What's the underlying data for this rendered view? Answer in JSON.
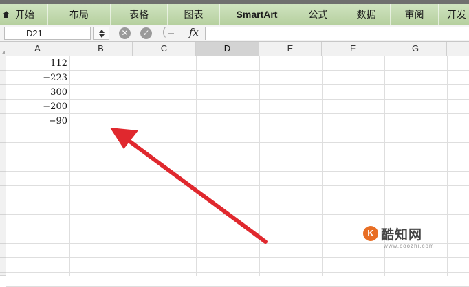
{
  "ribbon": {
    "tabs": [
      {
        "label": "开始"
      },
      {
        "label": "布局"
      },
      {
        "label": "表格"
      },
      {
        "label": "图表"
      },
      {
        "label": "SmartArt"
      },
      {
        "label": "公式"
      },
      {
        "label": "数据"
      },
      {
        "label": "审阅"
      },
      {
        "label": "开发"
      }
    ]
  },
  "formula_bar": {
    "name_box": "D21",
    "fx_label": "fx",
    "formula": ""
  },
  "sheet": {
    "columns": [
      "A",
      "B",
      "C",
      "D",
      "E",
      "F",
      "G"
    ],
    "selected_column": "D",
    "cells": {
      "A1": "112",
      "A2": "−223",
      "A3": "300",
      "A4": "−200",
      "A5": "−90"
    }
  },
  "annotation": {
    "arrow_color": "#e0282e"
  },
  "watermark": {
    "logo_letter": "K",
    "text": "酷知网",
    "url": "www.coozhi.com"
  },
  "colors": {
    "ribbon_bg": "#c3d9ae",
    "selected_column_header": "#d3d3d3",
    "gridline": "#dedede"
  }
}
